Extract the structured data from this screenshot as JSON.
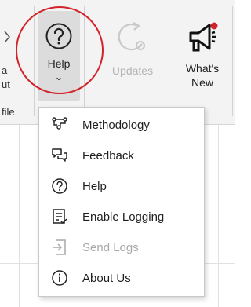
{
  "ribbon": {
    "partial_left": {
      "line1": "a",
      "line2": "ut",
      "group": "file"
    },
    "help": {
      "label": "Help",
      "dropdown_glyph": "⌄"
    },
    "updates": {
      "label": "Updates"
    },
    "whats_new": {
      "line1": "What's",
      "line2": "New"
    }
  },
  "help_menu": {
    "items": [
      {
        "label": "Methodology",
        "icon": "methodology-icon",
        "enabled": true
      },
      {
        "label": "Feedback",
        "icon": "feedback-icon",
        "enabled": true
      },
      {
        "label": "Help",
        "icon": "help-icon",
        "enabled": true
      },
      {
        "label": "Enable Logging",
        "icon": "logging-icon",
        "enabled": true
      },
      {
        "label": "Send Logs",
        "icon": "send-logs-icon",
        "enabled": false
      },
      {
        "label": "About Us",
        "icon": "info-icon",
        "enabled": true
      }
    ]
  },
  "colors": {
    "highlight_circle": "#d2232a",
    "notification_dot": "#d2232a",
    "disabled_text": "#a8a8a8"
  }
}
